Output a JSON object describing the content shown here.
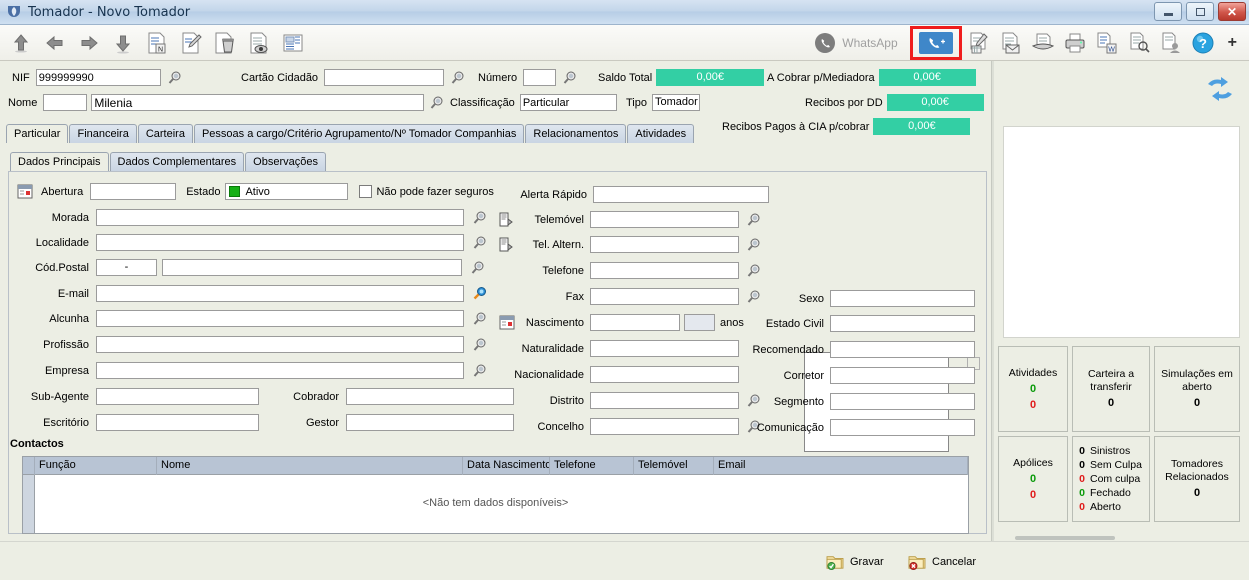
{
  "window": {
    "title": "Tomador - Novo Tomador",
    "controls": {
      "minimize": "minimize-button",
      "maximize": "maximize-button",
      "close": "close-button"
    }
  },
  "toolbar": {
    "left_icons": [
      "up-arrow-icon",
      "left-arrow-icon",
      "right-arrow-icon",
      "down-arrow-icon",
      "new-document-icon",
      "edit-document-icon",
      "delete-document-icon",
      "preview-document-icon",
      "list-document-icon"
    ],
    "whatsapp_label": "WhatsApp",
    "call_button": "add-call-button",
    "right_icons": [
      "calendar-document-icon",
      "email-document-icon",
      "scanner-icon",
      "printer-icon",
      "word-export-icon",
      "document-search-icon",
      "document-contact-icon"
    ],
    "help_label": "?",
    "plus_label": "+",
    "highlight_color": "#ef1d1d"
  },
  "header": {
    "nif_label": "NIF",
    "nif_value": "999999990",
    "cartao_label": "Cartão Cidadão",
    "cartao_value": "",
    "numero_label": "Número",
    "numero_value": "",
    "saldo_label": "Saldo Total",
    "saldo_value": "0,00€",
    "cobrar_label": "A Cobrar p/Mediadora",
    "cobrar_value": "0,00€",
    "nome_label": "Nome",
    "nome_prefix": "",
    "nome_value": "Milenia",
    "classificacao_label": "Classificação",
    "classificacao_value": "Particular",
    "tipo_label": "Tipo",
    "tipo_value": "Tomador",
    "recibos_dd_label": "Recibos por DD",
    "recibos_dd_value": "0,00€",
    "recibos_cia_label": "Recibos Pagos à CIA p/cobrar",
    "recibos_cia_value": "0,00€",
    "accent_green": "#33cfa4"
  },
  "tabs": [
    {
      "label": "Particular",
      "active": true
    },
    {
      "label": "Financeira",
      "active": false
    },
    {
      "label": "Carteira",
      "active": false
    },
    {
      "label": "Pessoas a cargo/Critério Agrupamento/Nº Tomador Companhias",
      "active": false
    },
    {
      "label": "Relacionamentos",
      "active": false
    },
    {
      "label": "Atividades",
      "active": false
    }
  ],
  "subtabs": [
    {
      "label": "Dados Principais",
      "active": true
    },
    {
      "label": "Dados Complementares",
      "active": false
    },
    {
      "label": "Observações",
      "active": false
    }
  ],
  "form": {
    "abertura_label": "Abertura",
    "abertura_value": "",
    "estado_label": "Estado",
    "estado_value": "Ativo",
    "nao_seguros_label": "Não pode fazer seguros",
    "morada_label": "Morada",
    "morada_value": "",
    "localidade_label": "Localidade",
    "localidade_value": "",
    "codpostal_label": "Cód.Postal",
    "codpostal_value": "-",
    "codpostal_extra": "",
    "email_label": "E-mail",
    "email_value": "",
    "alcunha_label": "Alcunha",
    "alcunha_value": "",
    "profissao_label": "Profissão",
    "profissao_value": "",
    "empresa_label": "Empresa",
    "empresa_value": "",
    "subagente_label": "Sub-Agente",
    "subagente_value": "",
    "cobrador_label": "Cobrador",
    "cobrador_value": "",
    "escritorio_label": "Escritório",
    "escritorio_value": "",
    "gestor_label": "Gestor",
    "gestor_value": "",
    "alerta_label": "Alerta Rápido",
    "alerta_value": "",
    "telemovel_label": "Telemóvel",
    "telemovel_value": "",
    "telaltern_label": "Tel. Altern.",
    "telaltern_value": "",
    "telefone_label": "Telefone",
    "telefone_value": "",
    "fax_label": "Fax",
    "fax_value": "",
    "nascimento_label": "Nascimento",
    "nascimento_value": "",
    "anos_value": "",
    "anos_label": "anos",
    "naturalidade_label": "Naturalidade",
    "naturalidade_value": "",
    "nacionalidade_label": "Nacionalidade",
    "nacionalidade_value": "",
    "distrito_label": "Distrito",
    "distrito_value": "",
    "concelho_label": "Concelho",
    "concelho_value": "",
    "sexo_label": "Sexo",
    "sexo_value": "",
    "estadocivil_label": "Estado Civil",
    "estadocivil_value": "",
    "recomendado_label": "Recomendado",
    "recomendado_value": "",
    "corretor_label": "Corretor",
    "corretor_value": "",
    "segmento_label": "Segmento",
    "segmento_value": "",
    "comunicacao_label": "Comunicação",
    "comunicacao_value": ""
  },
  "contacts": {
    "section_label": "Contactos",
    "columns": [
      "Função",
      "Nome",
      "Data Nascimento",
      "Telefone",
      "Telemóvel",
      "Email"
    ],
    "empty_message": "<Não tem dados disponíveis>",
    "rows": []
  },
  "sidebar": {
    "cards": [
      {
        "title": "Atividades",
        "values": [
          {
            "n": "0",
            "color": "green"
          },
          {
            "n": "0",
            "color": "red"
          }
        ]
      },
      {
        "title": "Carteira a transferir",
        "values": [
          {
            "n": "0",
            "color": "black"
          }
        ]
      },
      {
        "title": "Simulações em aberto",
        "values": [
          {
            "n": "0",
            "color": "black"
          }
        ]
      },
      {
        "title": "Apólices",
        "values": [
          {
            "n": "0",
            "color": "green"
          },
          {
            "n": "0",
            "color": "red"
          }
        ]
      },
      {
        "title": "Tomadores Relacionados",
        "values": [
          {
            "n": "0",
            "color": "black"
          }
        ]
      }
    ],
    "sinistros": [
      {
        "n": "0",
        "label": "Sinistros",
        "color": "black"
      },
      {
        "n": "0",
        "label": "Sem Culpa",
        "color": "black"
      },
      {
        "n": "0",
        "label": "Com culpa",
        "color": "red"
      },
      {
        "n": "0",
        "label": "Fechado",
        "color": "green"
      },
      {
        "n": "0",
        "label": "Aberto",
        "color": "red"
      }
    ],
    "refresh_icon": "refresh-icon"
  },
  "footer": {
    "save_label": "Gravar",
    "cancel_label": "Cancelar"
  }
}
